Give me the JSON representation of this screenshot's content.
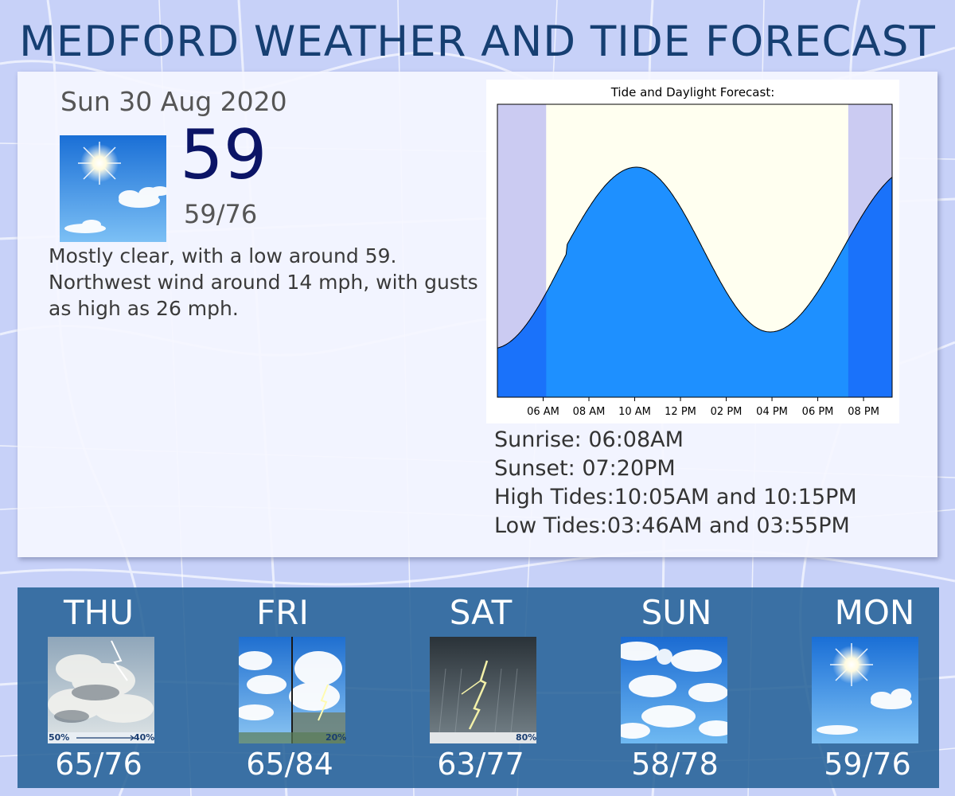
{
  "title": "MEDFORD WEATHER AND TIDE FORECAST",
  "current": {
    "date": "Sun 30 Aug 2020",
    "temp": "59",
    "range": "59/76",
    "icon": "sunny-clouds-icon",
    "description": "Mostly clear, with a low around 59. Northwest wind around 14 mph, with gusts as high as 26 mph."
  },
  "tide": {
    "sunrise_label": "Sunrise:",
    "sunrise": "06:08AM",
    "sunset_label": "Sunset:",
    "sunset": "07:20PM",
    "high_label": "High Tides:",
    "high": "10:05AM and 10:15PM",
    "low_label": "Low Tides:",
    "low": "03:46AM and 03:55PM"
  },
  "chart_data": {
    "type": "area",
    "title": "Tide and Daylight Forecast:",
    "xlabel": "",
    "ylabel": "",
    "x_ticks": [
      "06 AM",
      "08 AM",
      "10 AM",
      "12 PM",
      "02 PM",
      "04 PM",
      "06 PM",
      "08 PM"
    ],
    "xlim": [
      "04:00",
      "21:15"
    ],
    "daylight": [
      "06:08",
      "19:20"
    ],
    "tide_extrema": [
      {
        "time": "03:46",
        "kind": "low"
      },
      {
        "time": "10:05",
        "kind": "high"
      },
      {
        "time": "15:55",
        "kind": "low"
      },
      {
        "time": "22:15",
        "kind": "high"
      }
    ],
    "colors": {
      "night": "#cbcbf2",
      "day": "#fffff0",
      "water": "#1e90ff",
      "water_night": "#1a72fa"
    },
    "grid": false
  },
  "forecast": [
    {
      "day": "THU",
      "temps": "65/76",
      "icon": "thunderstorm-clouds-icon",
      "pct_left": "50%",
      "pct_right": "40%"
    },
    {
      "day": "FRI",
      "temps": "65/84",
      "icon": "partly-cloudy-then-storm-icon",
      "pct_right": "20%"
    },
    {
      "day": "SAT",
      "temps": "63/77",
      "icon": "lightning-rain-icon",
      "pct_right": "80%"
    },
    {
      "day": "SUN",
      "temps": "58/78",
      "icon": "partly-cloudy-icon"
    },
    {
      "day": "MON",
      "temps": "59/76",
      "icon": "sunny-clouds-icon"
    }
  ]
}
